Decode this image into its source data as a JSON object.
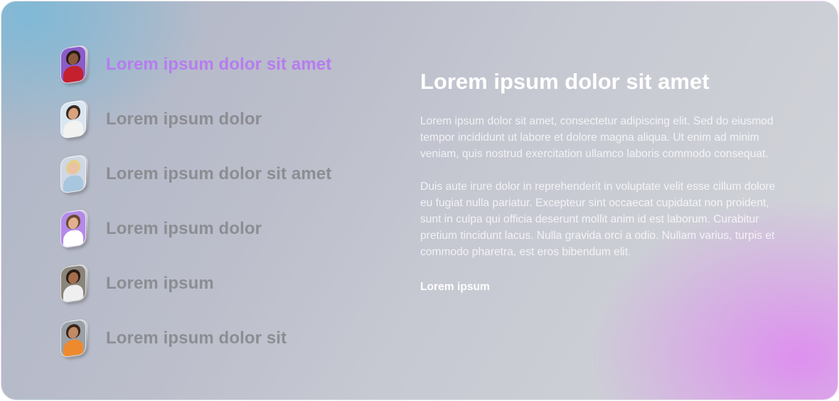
{
  "list": {
    "items": [
      {
        "label": "Lorem ipsum dolor sit amet",
        "active": true,
        "bg": "#8a5cc8",
        "skin": "#8b5a3c",
        "hair": "#2a1a12",
        "shirt": "#c4202e"
      },
      {
        "label": "Lorem ipsum dolor",
        "active": false,
        "bg": "#d9e6f2",
        "skin": "#d9a37e",
        "hair": "#3a2a20",
        "shirt": "#f2f2f0"
      },
      {
        "label": "Lorem ipsum dolor  sit amet",
        "active": false,
        "bg": "#cfd8e4",
        "skin": "#e9c3a2",
        "hair": "#e6cf8a",
        "shirt": "#a8c6dd"
      },
      {
        "label": "Lorem ipsum dolor",
        "active": false,
        "bg": "#b48ae8",
        "skin": "#e2b08f",
        "hair": "#6a4a30",
        "shirt": "#ffffff"
      },
      {
        "label": "Lorem ipsum",
        "active": false,
        "bg": "#8a857c",
        "skin": "#a36e4e",
        "hair": "#2a1c14",
        "shirt": "#efefef"
      },
      {
        "label": "Lorem ipsum dolor sit",
        "active": false,
        "bg": "#9aa0a8",
        "skin": "#c08a66",
        "hair": "#3b2518",
        "shirt": "#ee8a2e"
      }
    ]
  },
  "content": {
    "title": "Lorem ipsum dolor sit amet",
    "paragraph_1": "Lorem ipsum dolor sit amet, consectetur adipiscing elit. Sed do eiusmod tempor incididunt ut labore et dolore magna aliqua. Ut enim ad minim veniam, quis nostrud exercitation ullamco laboris commodo consequat.",
    "paragraph_2": "Duis aute irure dolor in reprehenderit in voluptate velit esse cillum dolore eu fugiat nulla pariatur. Excepteur sint occaecat cupidatat non proident, sunt in culpa qui officia deserunt mollit anim id est laborum. Curabitur pretium tincidunt lacus. Nulla gravida orci a odio. Nullam varius, turpis et commodo pharetra, est eros bibendum elit.",
    "link": "Lorem ipsum"
  },
  "colors": {
    "active_label": "#b67cf0",
    "inactive_label": "#8c8d92",
    "accent_glow": "#de8cf0",
    "top_left_glow": "#7db9d7"
  }
}
